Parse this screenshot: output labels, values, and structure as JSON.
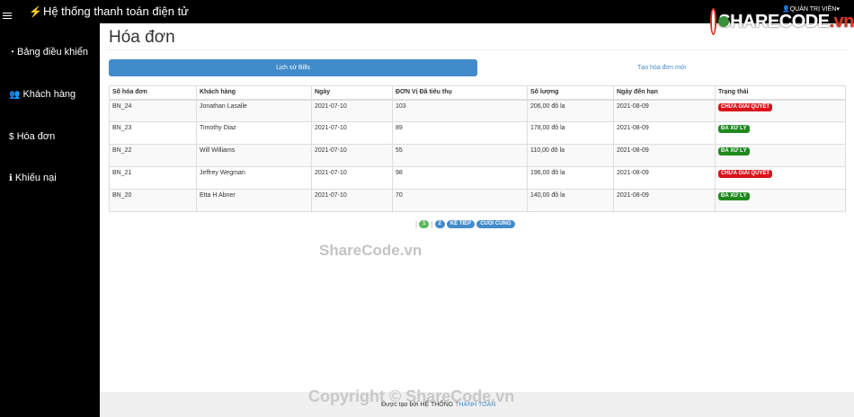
{
  "app": {
    "title": "Hệ thống thanh toán điện tử",
    "user_menu": "QUẢN TRỊ VIÊN"
  },
  "overlays": {
    "logo_text": "SHARECODE",
    "logo_suffix": ".vn",
    "watermark_mid": "ShareCode.vn",
    "watermark_footer": "Copyright © ShareCode.vn"
  },
  "sidebar": {
    "items": [
      {
        "icon": "dashboard-icon",
        "label": "Bảng điều khiển"
      },
      {
        "icon": "users-icon",
        "label": "Khách hàng"
      },
      {
        "icon": "dollar-icon",
        "label": "Hóa đơn"
      },
      {
        "icon": "info-icon",
        "label": "Khiếu nại"
      }
    ]
  },
  "page": {
    "title": "Hóa đơn",
    "tabs": [
      {
        "label": "Lịch sử Bills",
        "active": true
      },
      {
        "label": "Tạo hóa đơn mới",
        "active": false
      }
    ]
  },
  "table": {
    "headers": [
      "Số hóa đơn",
      "Khách hàng",
      "Ngày",
      "ĐƠN Vị Đã tiêu thụ",
      "Số lượng",
      "Ngày đến hạn",
      "Trạng thái"
    ],
    "rows": [
      {
        "id": "BN_24",
        "customer": "Jonathan Lasalle",
        "date": "2021-07-10",
        "units": "103",
        "amount": "206,00 đô la",
        "due": "2021-08-09",
        "status": "CHƯA GIẢI QUYẾT",
        "status_color": "#d9131b"
      },
      {
        "id": "BN_23",
        "customer": "Timothy Diaz",
        "date": "2021-07-10",
        "units": "89",
        "amount": "178,00 đô la",
        "due": "2021-08-09",
        "status": "ĐÃ XỬ LÝ",
        "status_color": "#1e8a1e"
      },
      {
        "id": "BN_22",
        "customer": "Will Williams",
        "date": "2021-07-10",
        "units": "55",
        "amount": "110,00 đô la",
        "due": "2021-08-09",
        "status": "ĐÃ XỬ LÝ",
        "status_color": "#1e8a1e"
      },
      {
        "id": "BN_21",
        "customer": "Jeffrey Wegman",
        "date": "2021-07-10",
        "units": "98",
        "amount": "196,00 đô la",
        "due": "2021-08-09",
        "status": "CHƯA GIẢI QUYẾT",
        "status_color": "#d9131b"
      },
      {
        "id": "BN_20",
        "customer": "Etta H Abner",
        "date": "2021-07-10",
        "units": "70",
        "amount": "140,00 đô la",
        "due": "2021-08-09",
        "status": "ĐÃ XỬ LÝ",
        "status_color": "#1e8a1e"
      }
    ]
  },
  "pagination": {
    "pages": [
      "1",
      "2"
    ],
    "current": "1",
    "next_label": "KẾ TIẾP",
    "last_label": "CUỐI CÙNG"
  },
  "footer": {
    "prefix": "Được tạo bởi HỆ THỐNG ",
    "link": "THANH TOÁN"
  },
  "colors": {
    "primary": "#428bca",
    "success": "#5cb85c",
    "danger": "#d9131b"
  }
}
